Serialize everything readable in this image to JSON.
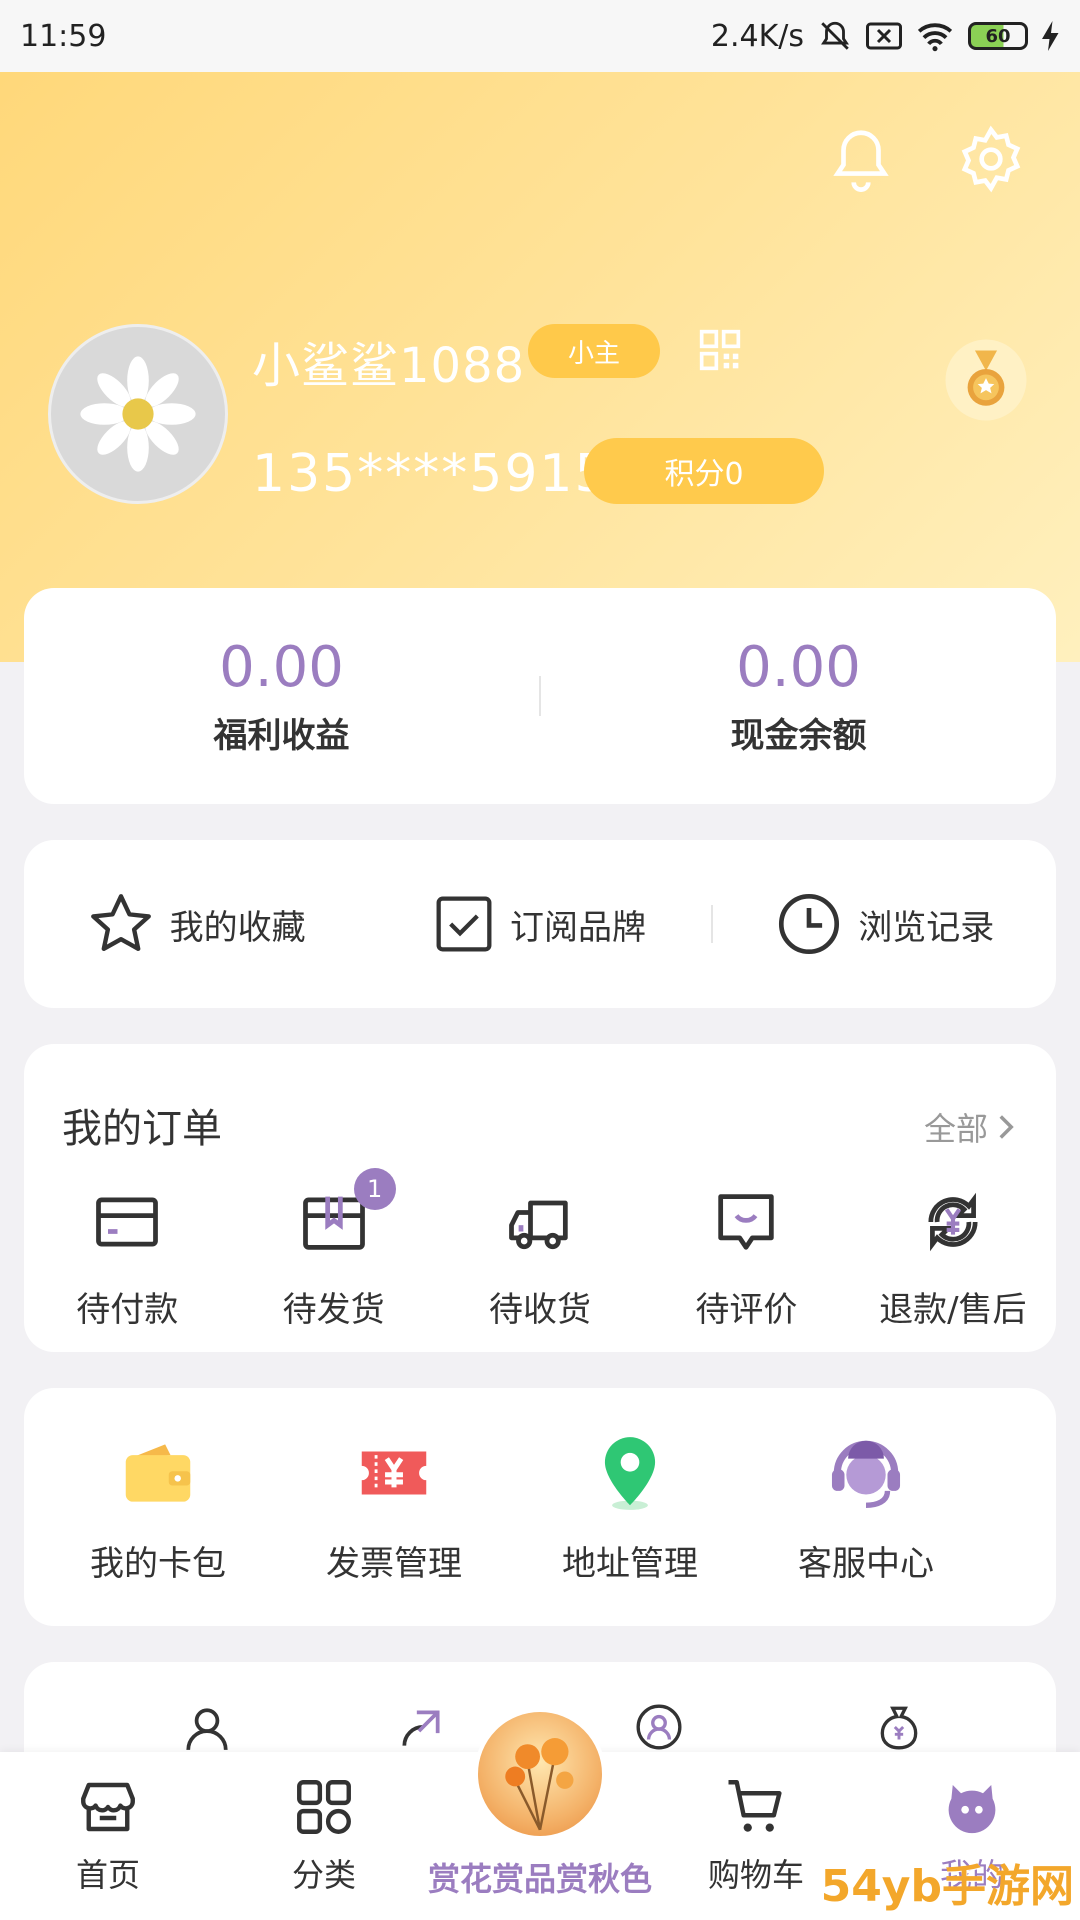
{
  "status": {
    "time": "11:59",
    "net_speed": "2.4K/s",
    "battery": "60"
  },
  "profile": {
    "username": "小鲨鲨1088",
    "level": "小主",
    "phone": "135****5915",
    "points": "积分0"
  },
  "balance": {
    "welfare_value": "0.00",
    "welfare_label": "福利收益",
    "cash_value": "0.00",
    "cash_label": "现金余额"
  },
  "quick": {
    "favorites": "我的收藏",
    "subscribe": "订阅品牌",
    "history": "浏览记录"
  },
  "orders": {
    "title": "我的订单",
    "all": "全部",
    "items": [
      {
        "label": "待付款",
        "icon": "card-icon"
      },
      {
        "label": "待发货",
        "icon": "box-icon",
        "badge": "1"
      },
      {
        "label": "待收货",
        "icon": "truck-icon"
      },
      {
        "label": "待评价",
        "icon": "comment-icon"
      },
      {
        "label": "退款/售后",
        "icon": "refund-icon"
      }
    ]
  },
  "tools": [
    {
      "label": "我的卡包",
      "icon": "wallet-icon"
    },
    {
      "label": "发票管理",
      "icon": "invoice-icon"
    },
    {
      "label": "地址管理",
      "icon": "location-icon"
    },
    {
      "label": "客服中心",
      "icon": "customer-service-icon"
    }
  ],
  "tabs": {
    "home": "首页",
    "category": "分类",
    "center": "赏花赏品赏秋色",
    "cart": "购物车",
    "mine": "我的"
  },
  "watermark": "54yb手游网",
  "colors": {
    "accent": "#9b7dc0",
    "hero_start": "#ffd87a",
    "badge": "#ffc94a"
  }
}
